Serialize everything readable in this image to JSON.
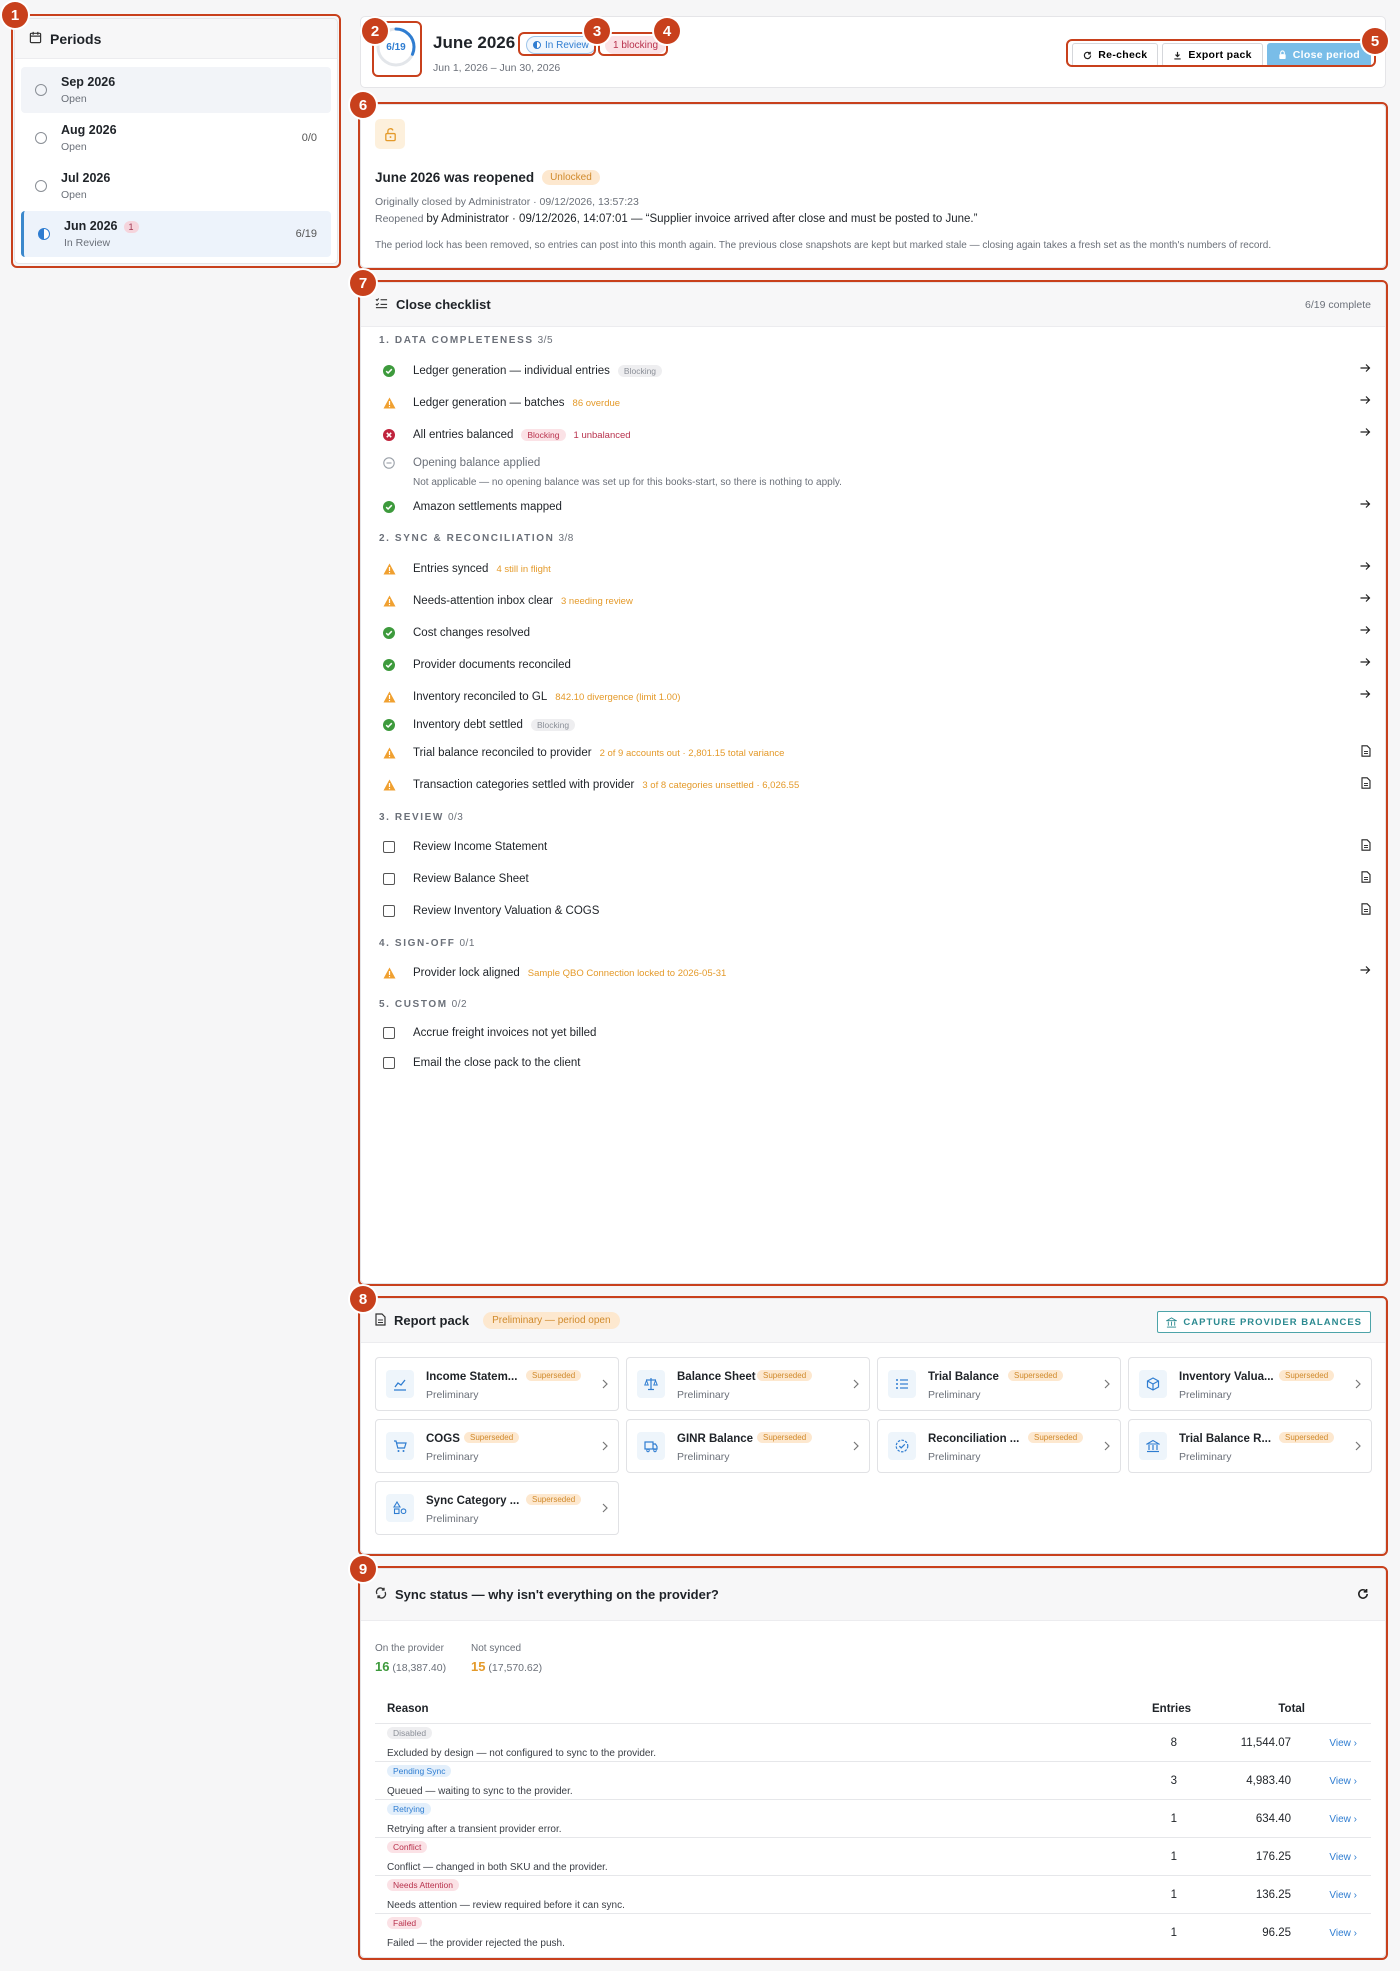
{
  "sidebar": {
    "title": "Periods",
    "items": [
      {
        "name": "Sep 2026",
        "status": "Open",
        "count": "",
        "badge": ""
      },
      {
        "name": "Aug 2026",
        "status": "Open",
        "count": "0/0",
        "badge": ""
      },
      {
        "name": "Jul 2026",
        "status": "Open",
        "count": "",
        "badge": ""
      },
      {
        "name": "Jun 2026",
        "status": "In Review",
        "count": "6/19",
        "badge": "1"
      }
    ]
  },
  "header": {
    "progress_label": "6/19",
    "progress_fraction": 0.3158,
    "title": "June 2026",
    "date_range": "Jun 1, 2026 – Jun 30, 2026",
    "status_chip": "In Review",
    "blocking_chip": "1 blocking",
    "buttons": {
      "recheck": "Re-check",
      "export": "Export pack",
      "close": "Close period"
    }
  },
  "reopened": {
    "title": "June 2026 was reopened",
    "chip": "Unlocked",
    "closed_line": "Originally closed by Administrator · 09/12/2026, 13:57:23",
    "reopened_prefix": "Reopened",
    "reopened_rest": "by Administrator · 09/12/2026, 14:07:01 — “Supplier invoice arrived after close and must be posted to June.”",
    "explanation": "The period lock has been removed, so entries can post into this month again. The previous close snapshots are kept but marked stale — closing again takes a fresh set as the month's numbers of record."
  },
  "checklist": {
    "title": "Close checklist",
    "complete": "6/19 complete",
    "sections": [
      {
        "title": "1. DATA COMPLETENESS",
        "count": "3/5"
      },
      {
        "title": "2. SYNC & RECONCILIATION",
        "count": "3/8"
      },
      {
        "title": "3. REVIEW",
        "count": "0/3"
      },
      {
        "title": "4. SIGN-OFF",
        "count": "0/1"
      },
      {
        "title": "5. CUSTOM",
        "count": "0/2"
      }
    ],
    "items": [
      {
        "label": "Ledger generation — individual entries",
        "tag": "Blocking",
        "detail": ""
      },
      {
        "label": "Ledger generation — batches",
        "tag": "",
        "detail": "86 overdue"
      },
      {
        "label": "All entries balanced",
        "tag": "Blocking",
        "detail": "1 unbalanced"
      },
      {
        "label": "Opening balance applied",
        "tag": "",
        "detail": "Not applicable — no opening balance was set up for this books-start, so there is nothing to apply."
      },
      {
        "label": "Amazon settlements mapped",
        "tag": "",
        "detail": ""
      },
      {
        "label": "Entries synced",
        "tag": "",
        "detail": "4 still in flight"
      },
      {
        "label": "Needs-attention inbox clear",
        "tag": "",
        "detail": "3 needing review"
      },
      {
        "label": "Cost changes resolved",
        "tag": "",
        "detail": ""
      },
      {
        "label": "Provider documents reconciled",
        "tag": "",
        "detail": ""
      },
      {
        "label": "Inventory reconciled to GL",
        "tag": "",
        "detail": "842.10 divergence (limit 1.00)"
      },
      {
        "label": "Inventory debt settled",
        "tag": "Blocking",
        "detail": ""
      },
      {
        "label": "Trial balance reconciled to provider",
        "tag": "",
        "detail": "2 of 9 accounts out · 2,801.15 total variance"
      },
      {
        "label": "Transaction categories settled with provider",
        "tag": "",
        "detail": "3 of 8 categories unsettled · 6,026.55"
      },
      {
        "label": "Review Income Statement",
        "tag": "",
        "detail": ""
      },
      {
        "label": "Review Balance Sheet",
        "tag": "",
        "detail": ""
      },
      {
        "label": "Review Inventory Valuation & COGS",
        "tag": "",
        "detail": ""
      },
      {
        "label": "Provider lock aligned",
        "tag": "",
        "detail": "Sample QBO Connection locked to 2026-05-31"
      },
      {
        "label": "Accrue freight invoices not yet billed",
        "tag": "",
        "detail": ""
      },
      {
        "label": "Email the close pack to the client",
        "tag": "",
        "detail": ""
      }
    ]
  },
  "report_pack": {
    "title": "Report pack",
    "chip": "Preliminary — period open",
    "capture": "CAPTURE PROVIDER BALANCES",
    "cards": [
      {
        "name": "Income Statem...",
        "tag": "Superseded",
        "sub": "Preliminary"
      },
      {
        "name": "Balance Sheet",
        "tag": "Superseded",
        "sub": "Preliminary"
      },
      {
        "name": "Trial Balance",
        "tag": "Superseded",
        "sub": "Preliminary"
      },
      {
        "name": "Inventory Valua...",
        "tag": "Superseded",
        "sub": "Preliminary"
      },
      {
        "name": "COGS",
        "tag": "Superseded",
        "sub": "Preliminary"
      },
      {
        "name": "GINR Balance",
        "tag": "Superseded",
        "sub": "Preliminary"
      },
      {
        "name": "Reconciliation ...",
        "tag": "Superseded",
        "sub": "Preliminary"
      },
      {
        "name": "Trial Balance R...",
        "tag": "Superseded",
        "sub": "Preliminary"
      },
      {
        "name": "Sync Category ...",
        "tag": "Superseded",
        "sub": "Preliminary"
      }
    ]
  },
  "sync": {
    "title": "Sync status — why isn't everything on the provider?",
    "on_provider_label": "On the provider",
    "on_provider_count": "16",
    "on_provider_total": "(18,387.40)",
    "not_synced_label": "Not synced",
    "not_synced_count": "15",
    "not_synced_total": "(17,570.62)",
    "columns": {
      "reason": "Reason",
      "entries": "Entries",
      "total": "Total"
    },
    "view": "View",
    "rows": [
      {
        "tag": "Disabled",
        "desc": "Excluded by design — not configured to sync to the provider.",
        "entries": "8",
        "total": "11,544.07"
      },
      {
        "tag": "Pending Sync",
        "desc": "Queued — waiting to sync to the provider.",
        "entries": "3",
        "total": "4,983.40"
      },
      {
        "tag": "Retrying",
        "desc": "Retrying after a transient provider error.",
        "entries": "1",
        "total": "634.40"
      },
      {
        "tag": "Conflict",
        "desc": "Conflict — changed in both SKU and the provider.",
        "entries": "1",
        "total": "176.25"
      },
      {
        "tag": "Needs Attention",
        "desc": "Needs attention — review required before it can sync.",
        "entries": "1",
        "total": "136.25"
      },
      {
        "tag": "Failed",
        "desc": "Failed — the provider rejected the push.",
        "entries": "1",
        "total": "96.25"
      }
    ]
  },
  "markers": [
    "1",
    "2",
    "3",
    "4",
    "5",
    "6",
    "7",
    "8",
    "9"
  ]
}
